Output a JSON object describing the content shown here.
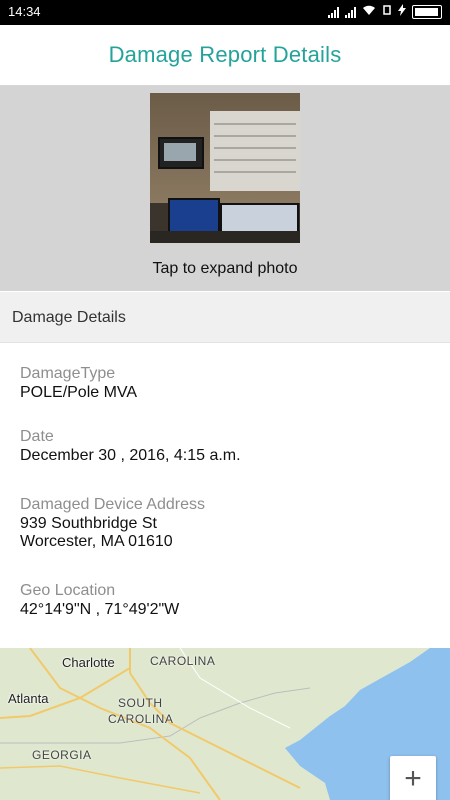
{
  "status_bar": {
    "time": "14:34"
  },
  "header": {
    "title": "Damage Report Details"
  },
  "photo": {
    "tap_label": "Tap to expand photo"
  },
  "section": {
    "title": "Damage Details"
  },
  "details": {
    "damage_type_label": "DamageType",
    "damage_type_value": "POLE/Pole MVA",
    "date_label": "Date",
    "date_value": "December 30 , 2016, 4:15 a.m.",
    "address_label": "Damaged Device Address",
    "address_line1": "939 Southbridge St",
    "address_line2": "Worcester, MA 01610",
    "geo_label": "Geo Location",
    "geo_value": "42°14'9\"N , 71°49'2\"W"
  },
  "map": {
    "places": [
      "Charlotte",
      "Atlanta"
    ],
    "states": [
      "CAROLINA",
      "SOUTH",
      "CAROLINA",
      "GEORGIA"
    ],
    "zoom_in_label": "+"
  },
  "colors": {
    "accent": "#24a39a",
    "header_bg": "#ffffff",
    "photo_bg": "#d4d4d4",
    "section_bg": "#f0f0f0",
    "map_land": "#dfe8cf",
    "map_water": "#8fc1ee"
  }
}
